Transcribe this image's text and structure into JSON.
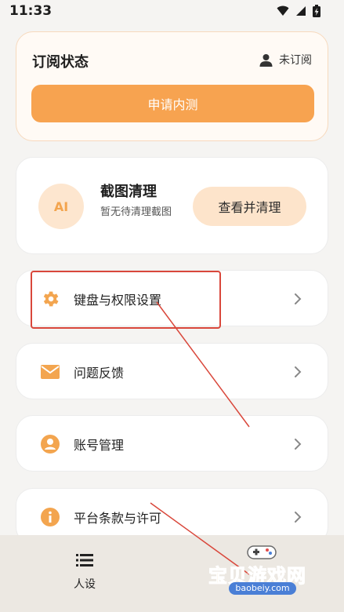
{
  "status_bar": {
    "time": "11:33",
    "icons": [
      "wifi-icon",
      "cellular-signal-icon",
      "battery-charging-icon"
    ]
  },
  "subscription": {
    "title": "订阅状态",
    "status_icon": "user-icon",
    "status_text": "未订阅",
    "apply_button": "申请内测"
  },
  "screenshot_cleanup": {
    "badge": "AI",
    "title": "截图清理",
    "description": "暂无待清理截图",
    "button": "查看并清理"
  },
  "menu": [
    {
      "icon": "gear-icon",
      "label": "键盘与权限设置"
    },
    {
      "icon": "mail-icon",
      "label": "问题反馈"
    },
    {
      "icon": "account-icon",
      "label": "账号管理"
    },
    {
      "icon": "info-icon",
      "label": "平台条款与许可"
    }
  ],
  "bottom_nav": {
    "item_icon": "list-menu-icon",
    "item_label": "人设"
  },
  "watermark": {
    "text": "宝贝游戏网",
    "url": "baobeiy.com"
  },
  "colors": {
    "accent": "#f7a350",
    "accent_light": "#fde4cb",
    "background": "#f5f4f2",
    "annotation": "#d9473b"
  }
}
